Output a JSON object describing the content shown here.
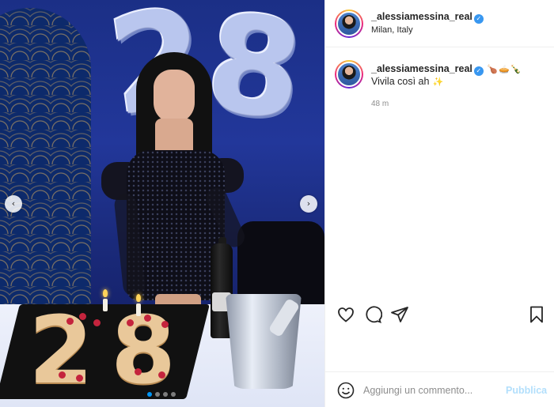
{
  "post": {
    "username": "_alessiamessina_real",
    "location": "Milan, Italy",
    "caption_emojis": [
      "🍗",
      "🥧",
      "🍾"
    ],
    "caption_text": "Vivila così ah",
    "caption_emoji_end": "✨",
    "time_ago": "48 m"
  },
  "photo": {
    "balloon_digits": [
      "2",
      "8"
    ],
    "cake_digits": [
      "2",
      "8"
    ],
    "carousel_count": 4,
    "carousel_active_index": 0
  },
  "icons": {
    "nav_left": "‹",
    "nav_right": "›",
    "verified": "✓",
    "like": "heart-icon",
    "comment": "comment-icon",
    "share": "share-icon",
    "save": "bookmark-icon",
    "emoji": "smiley-icon"
  },
  "add_comment": {
    "placeholder": "Aggiungi un commento...",
    "publish_label": "Pubblica"
  },
  "colors": {
    "accent": "#0095f6",
    "publish_disabled": "#b2dffc",
    "verified": "#3897f0"
  }
}
